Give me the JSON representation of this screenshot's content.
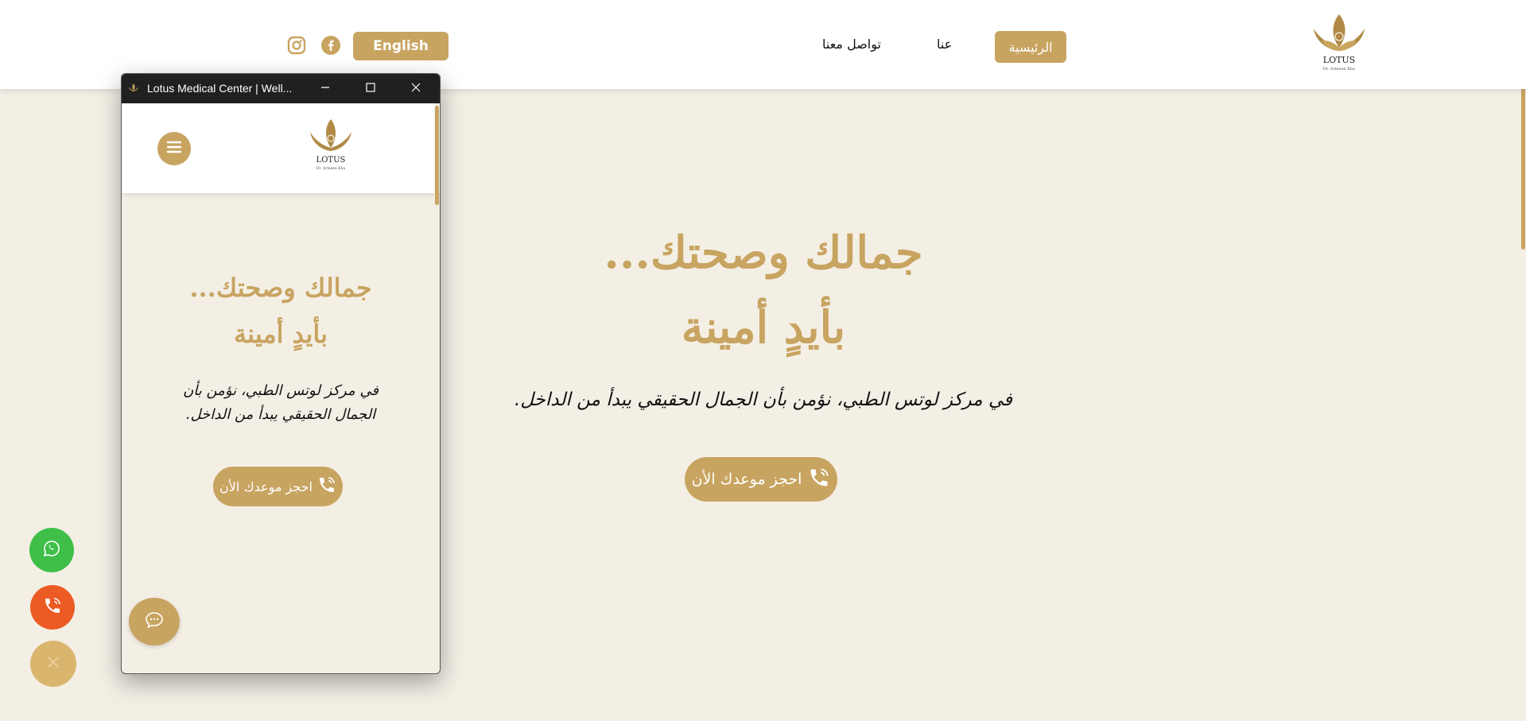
{
  "colors": {
    "gold": "#c8a461",
    "background": "#f4efe5",
    "whatsapp": "#3fbf48",
    "call": "#ec5b24"
  },
  "header": {
    "logo_text": "LOTUS",
    "logo_subtext": "Dr. Armeen Kha",
    "nav": {
      "home": "الرئيسية",
      "about": "عنا",
      "contact": "تواصل معنا"
    },
    "language_button": "English",
    "social": [
      "facebook-icon",
      "instagram-icon"
    ]
  },
  "hero": {
    "line1": "جمالك وصحتك...",
    "line2": "بأيدٍ أمينة",
    "subtitle": "في مركز لوتس الطبي، نؤمن بأن الجمال الحقيقي يبدأ من الداخل.",
    "cta": "احجز موعدك الأن"
  },
  "floating_buttons": [
    "whatsapp-icon",
    "phone-icon",
    "close-icon"
  ],
  "popup": {
    "title": "Lotus Medical Center | Well...",
    "hero_line1": "جمالك وصحتك...",
    "hero_line2": "بأيدٍ أمينة",
    "subtitle_line1": "في مركز لوتس الطبي، نؤمن بأن",
    "subtitle_line2": "الجمال الحقيقي يبدأ من الداخل.",
    "cta": "احجز موعدك الأن"
  }
}
